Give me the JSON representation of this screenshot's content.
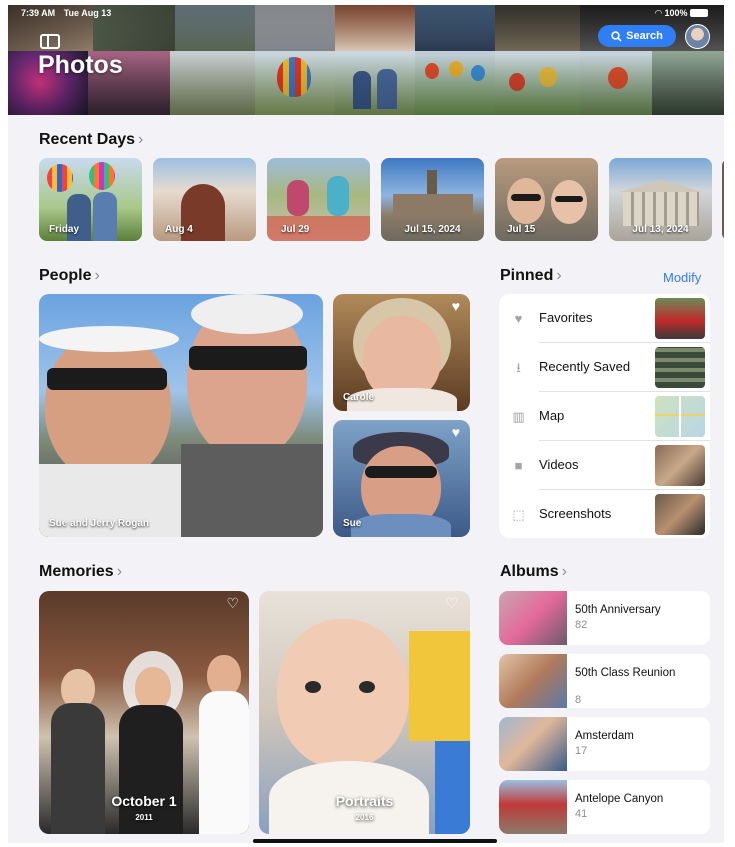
{
  "status_bar": {
    "time": "7:39 AM",
    "date": "Tue Aug 13",
    "wifi": "wifi-icon",
    "battery_pct": "100%"
  },
  "header": {
    "title": "Photos",
    "search_label": "Search"
  },
  "recent_days": {
    "title": "Recent Days",
    "items": [
      {
        "label": "Friday"
      },
      {
        "label": "Aug 4"
      },
      {
        "label": "Jul 29"
      },
      {
        "label": "Jul 15, 2024"
      },
      {
        "label": "Jul 15"
      },
      {
        "label": "Jul 13, 2024"
      }
    ]
  },
  "people": {
    "title": "People",
    "items": [
      {
        "label": "Sue and Jerry Rogan"
      },
      {
        "label": "Carole"
      },
      {
        "label": "Sue"
      }
    ]
  },
  "pinned": {
    "title": "Pinned",
    "modify_label": "Modify",
    "items": [
      {
        "label": "Favorites",
        "icon": "heart-icon"
      },
      {
        "label": "Recently Saved",
        "icon": "download-tray-icon"
      },
      {
        "label": "Map",
        "icon": "map-icon"
      },
      {
        "label": "Videos",
        "icon": "video-camera-icon"
      },
      {
        "label": "Screenshots",
        "icon": "screenshot-icon"
      }
    ]
  },
  "memories": {
    "title": "Memories",
    "items": [
      {
        "title": "October 1",
        "subtitle": "2011"
      },
      {
        "title": "Portraits",
        "subtitle": "2016"
      }
    ]
  },
  "albums": {
    "title": "Albums",
    "items": [
      {
        "name": "50th Anniversary",
        "count": "82"
      },
      {
        "name": "50th Class Reunion",
        "count": "8"
      },
      {
        "name": "Amsterdam",
        "count": "17"
      },
      {
        "name": "Antelope Canyon",
        "count": "41"
      }
    ]
  },
  "colors": {
    "accent": "#2f7ef5",
    "background": "#f2f2f7",
    "secondary_text": "#8e8e93"
  }
}
